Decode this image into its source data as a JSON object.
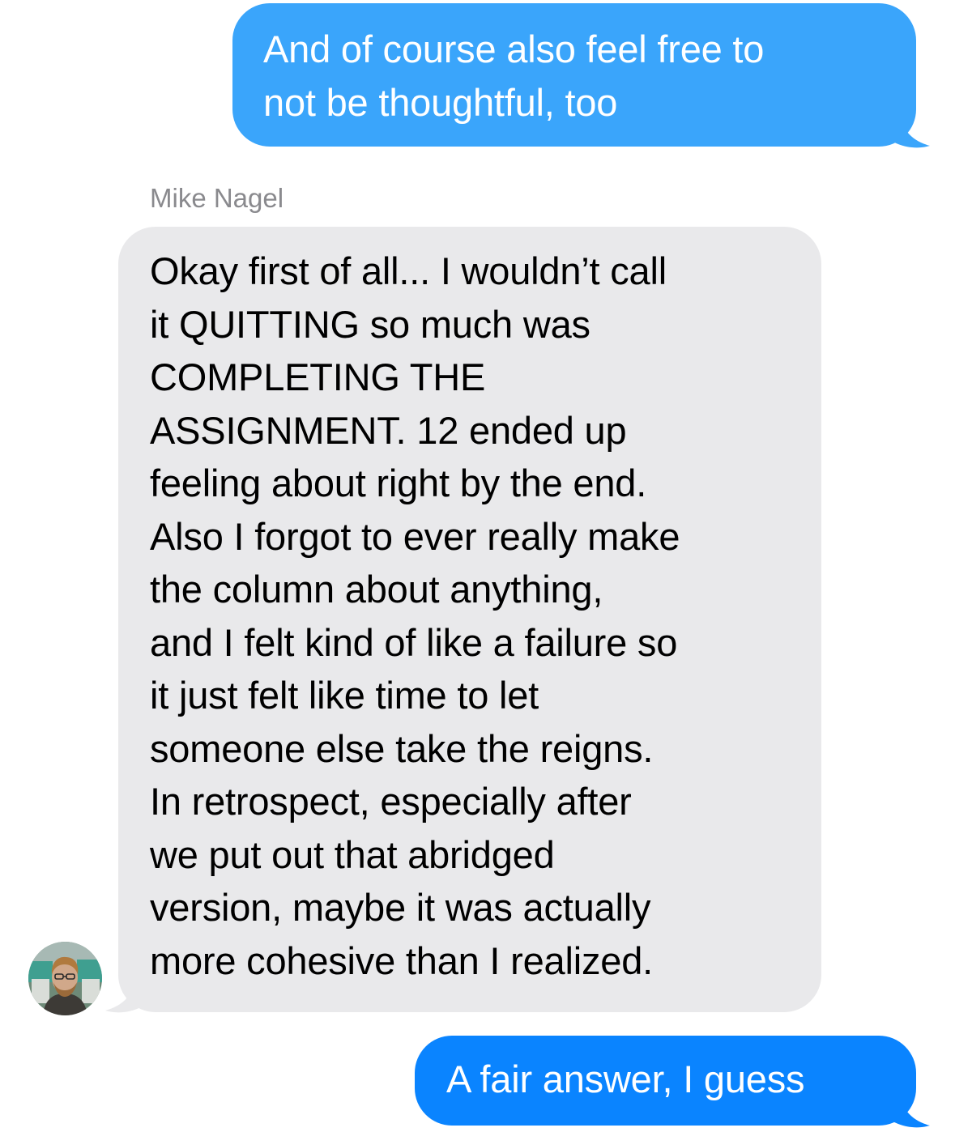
{
  "conversation": {
    "messages": [
      {
        "direction": "sent",
        "text": "And of course also feel free to\nnot be thoughtful, too",
        "bubble_color": "#3aa5fb"
      },
      {
        "direction": "received",
        "sender": "Mike Nagel",
        "text": "Okay first of all... I wouldn’t call\nit QUITTING so much was\nCOMPLETING THE\nASSIGNMENT. 12 ended up\nfeeling about right by the end.\nAlso I forgot to ever really make\nthe column about anything,\nand I felt kind of like a failure so\nit just felt like time to let\nsomeone else take the reigns.\nIn retrospect, especially after\nwe put out that abridged\nversion, maybe it was actually\nmore cohesive than I realized.",
        "bubble_color": "#e9e9eb",
        "avatar_icon": "contact-photo-avatar"
      },
      {
        "direction": "sent",
        "text": "A fair answer, I guess",
        "bubble_color": "#0a84ff"
      }
    ]
  }
}
